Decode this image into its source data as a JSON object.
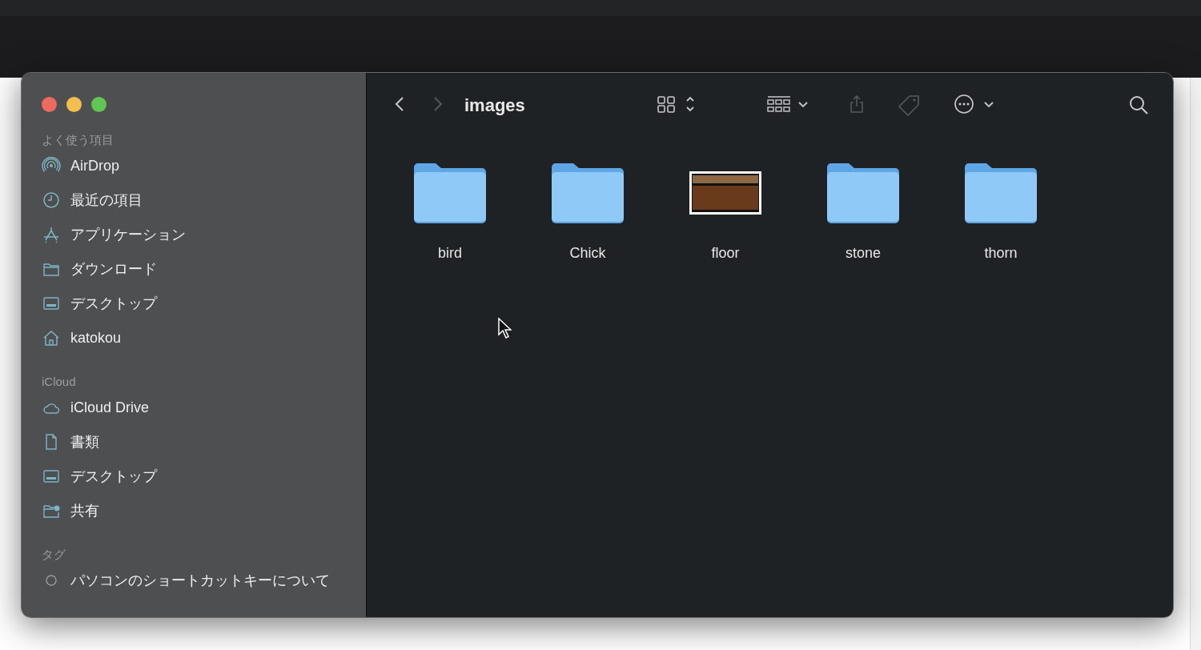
{
  "window": {
    "title": "images"
  },
  "toolbar_buttons": [
    {
      "kind": "back",
      "disabled": false
    },
    {
      "kind": "forward",
      "disabled": true
    },
    {
      "kind": "view",
      "disabled": false
    },
    {
      "kind": "group",
      "disabled": false
    },
    {
      "kind": "share",
      "disabled": true
    },
    {
      "kind": "tag",
      "disabled": true
    },
    {
      "kind": "more",
      "disabled": false
    },
    {
      "kind": "search",
      "disabled": false
    }
  ],
  "sidebar": {
    "sections": [
      {
        "heading": "よく使う項目",
        "items": [
          {
            "kind": "airdrop",
            "label": "AirDrop"
          },
          {
            "kind": "recent",
            "label": "最近の項目"
          },
          {
            "kind": "apps",
            "label": "アプリケーション"
          },
          {
            "kind": "folder",
            "label": "ダウンロード"
          },
          {
            "kind": "desktop",
            "label": "デスクトップ"
          },
          {
            "kind": "home",
            "label": "katokou"
          }
        ]
      },
      {
        "heading": "iCloud",
        "items": [
          {
            "kind": "cloud",
            "label": "iCloud Drive"
          },
          {
            "kind": "document",
            "label": "書類"
          },
          {
            "kind": "desktop",
            "label": "デスクトップ"
          },
          {
            "kind": "shared",
            "label": "共有"
          }
        ]
      },
      {
        "heading": "タグ",
        "items": [
          {
            "kind": "tag",
            "label": "パソコンのショートカットキーについて"
          }
        ]
      }
    ]
  },
  "files": [
    {
      "kind": "folder",
      "name": "bird"
    },
    {
      "kind": "folder",
      "name": "Chick"
    },
    {
      "kind": "image",
      "name": "floor"
    },
    {
      "kind": "folder",
      "name": "stone"
    },
    {
      "kind": "folder",
      "name": "thorn"
    }
  ]
}
